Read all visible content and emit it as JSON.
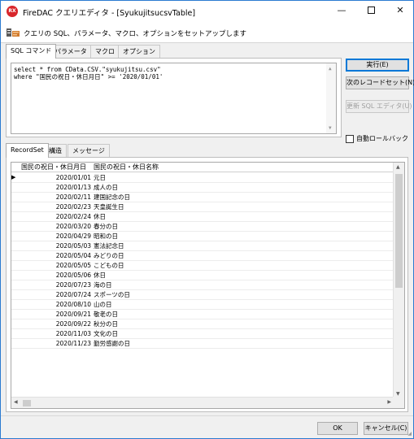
{
  "window": {
    "icon_text": "RX",
    "title": "FireDAC クエリエディタ - [SyukujitsucsvTable]",
    "minimize_glyph": "—",
    "close_glyph": "✕"
  },
  "header": {
    "icon": "sql-editor-icon",
    "text": "クエリの SQL、パラメータ、マクロ、オプションをセットアップします"
  },
  "top_tabs": [
    "SQL コマンド",
    "パラメータ",
    "マクロ",
    "オプション"
  ],
  "sql": {
    "lines": [
      "select * from CData.CSV.\"syukujitsu.csv\"",
      "where \"国民の祝日・休日月日\" >= '2020/01/01'"
    ]
  },
  "buttons": {
    "execute": "実行(E)",
    "next_recordset": "次のレコードセット(N)",
    "update_sql_editor": "更新 SQL エディタ(U)",
    "ok": "OK",
    "cancel": "キャンセル(C)"
  },
  "auto_rollback": {
    "label": "自動ロールバック",
    "checked": false
  },
  "bottom_tabs": [
    "RecordSet",
    "構造",
    "メッセージ"
  ],
  "grid": {
    "columns": [
      "国民の祝日・休日月日",
      "国民の祝日・休日名称"
    ],
    "current_row_marker": "▶",
    "rows": [
      [
        "2020/01/01",
        "元日"
      ],
      [
        "2020/01/13",
        "成人の日"
      ],
      [
        "2020/02/11",
        "建国記念の日"
      ],
      [
        "2020/02/23",
        "天皇誕生日"
      ],
      [
        "2020/02/24",
        "休日"
      ],
      [
        "2020/03/20",
        "春分の日"
      ],
      [
        "2020/04/29",
        "昭和の日"
      ],
      [
        "2020/05/03",
        "憲法記念日"
      ],
      [
        "2020/05/04",
        "みどりの日"
      ],
      [
        "2020/05/05",
        "こどもの日"
      ],
      [
        "2020/05/06",
        "休日"
      ],
      [
        "2020/07/23",
        "海の日"
      ],
      [
        "2020/07/24",
        "スポーツの日"
      ],
      [
        "2020/08/10",
        "山の日"
      ],
      [
        "2020/09/21",
        "敬老の日"
      ],
      [
        "2020/09/22",
        "秋分の日"
      ],
      [
        "2020/11/03",
        "文化の日"
      ],
      [
        "2020/11/23",
        "勤労感謝の日"
      ]
    ]
  }
}
